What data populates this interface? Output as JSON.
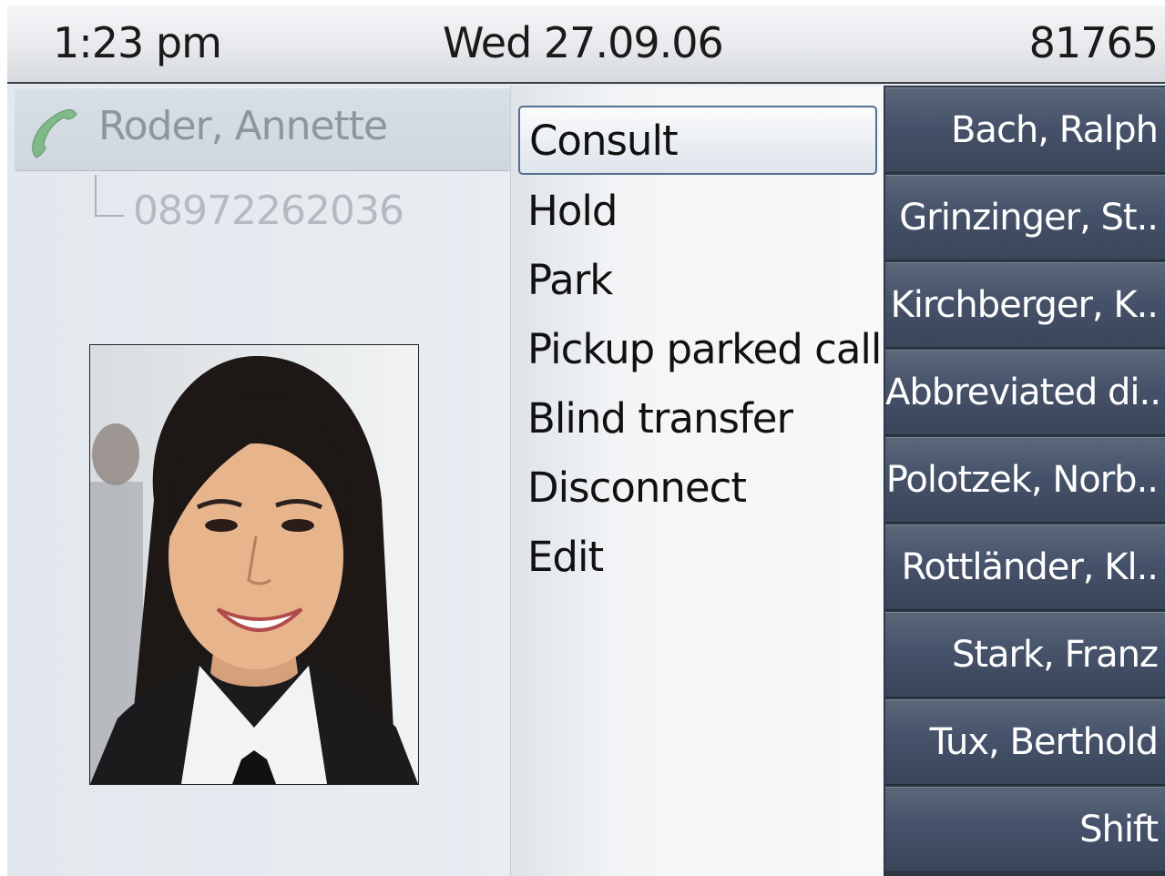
{
  "status_bar": {
    "time": "1:23 pm",
    "date": "Wed 27.09.06",
    "extension": "81765"
  },
  "caller": {
    "name": "Roder, Annette",
    "number": "08972262036",
    "phone_icon": "handset-icon",
    "photo": "caller-photo"
  },
  "menu": {
    "items": [
      {
        "label": "Consult",
        "selected": true
      },
      {
        "label": "Hold"
      },
      {
        "label": "Park"
      },
      {
        "label": "Pickup parked call"
      },
      {
        "label": "Blind transfer"
      },
      {
        "label": "Disconnect"
      },
      {
        "label": "Edit"
      }
    ]
  },
  "function_keys": [
    {
      "label": "Bach, Ralph"
    },
    {
      "label": "Grinzinger, St.."
    },
    {
      "label": "Kirchberger, K.."
    },
    {
      "label": "Abbreviated di.."
    },
    {
      "label": "Polotzek, Norb.."
    },
    {
      "label": "Rottländer, Kl.."
    },
    {
      "label": "Stark, Franz"
    },
    {
      "label": "Tux, Berthold"
    },
    {
      "label": "Shift"
    }
  ],
  "colors": {
    "accent": "#4f6a8f",
    "key_background": "#46526a",
    "handset": "#7fb98a"
  }
}
